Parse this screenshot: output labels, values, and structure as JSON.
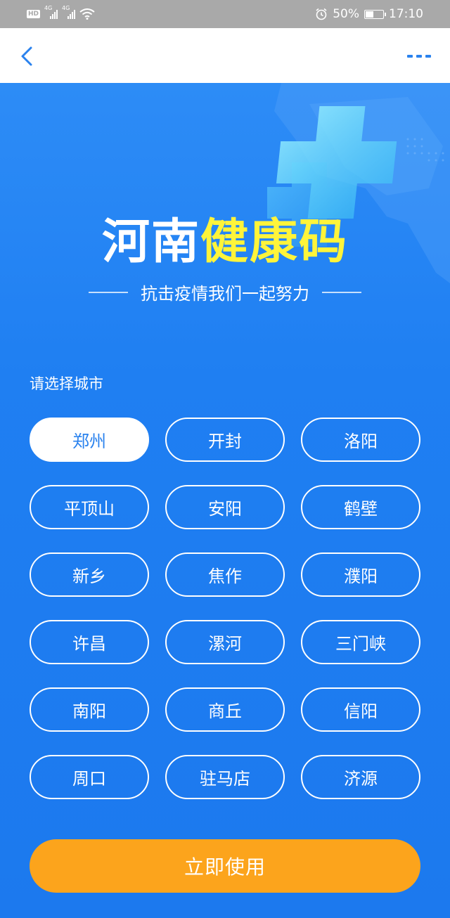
{
  "status_bar": {
    "hd": "HD",
    "sim1": "4G",
    "sim2": "4G",
    "battery_percent": "50%",
    "battery_level": 0.5,
    "time": "17:10",
    "icons": [
      "hd-icon",
      "signal-icon",
      "wifi-icon",
      "alarm-icon",
      "battery-icon"
    ]
  },
  "navbar": {
    "back_icon": "chevron-left-icon",
    "more_icon": "more-dots-icon",
    "accent": "#2a82ee"
  },
  "hero": {
    "title_white": "河南",
    "title_yellow": "健康码",
    "subtitle": "抗击疫情我们一起努力",
    "title_yellow_color": "#fff43a"
  },
  "city_select": {
    "label": "请选择城市",
    "selected": "郑州",
    "cities": [
      "郑州",
      "开封",
      "洛阳",
      "平顶山",
      "安阳",
      "鹤壁",
      "新乡",
      "焦作",
      "濮阳",
      "许昌",
      "漯河",
      "三门峡",
      "南阳",
      "商丘",
      "信阳",
      "周口",
      "驻马店",
      "济源"
    ]
  },
  "action": {
    "label": "立即使用",
    "color": "#fca41c"
  },
  "colors": {
    "background": "#1f7cf0",
    "status_bar": "#a9a9a9"
  }
}
